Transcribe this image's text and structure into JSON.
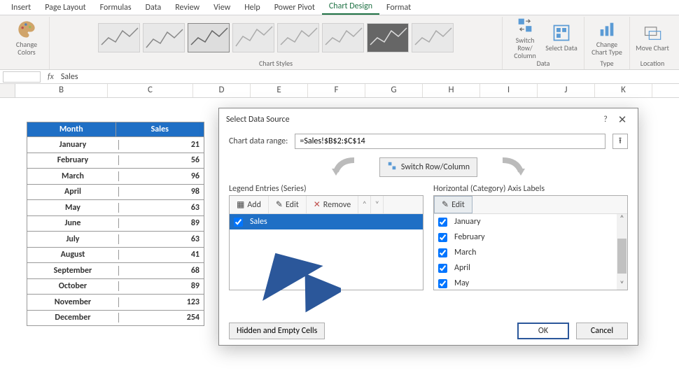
{
  "ribbon": {
    "tabs": [
      "Insert",
      "Page Layout",
      "Formulas",
      "Data",
      "Review",
      "View",
      "Help",
      "Power Pivot",
      "Chart Design",
      "Format"
    ],
    "active_tab": "Chart Design",
    "groups": {
      "change_colors": "Change\nColors",
      "chart_styles": "Chart Styles",
      "switch_rc": "Switch Row/\nColumn",
      "select_data": "Select\nData",
      "data": "Data",
      "change_type": "Change\nChart Type",
      "type": "Type",
      "move_chart": "Move\nChart",
      "location": "Location"
    }
  },
  "formula_bar": {
    "fx": "fx",
    "value": "Sales"
  },
  "columns": [
    "B",
    "C",
    "D",
    "E",
    "F",
    "G",
    "H",
    "I",
    "J",
    "K"
  ],
  "table": {
    "headers": {
      "month": "Month",
      "sales": "Sales"
    },
    "rows": [
      {
        "m": "January",
        "v": "21"
      },
      {
        "m": "February",
        "v": "56"
      },
      {
        "m": "March",
        "v": "96"
      },
      {
        "m": "April",
        "v": "98"
      },
      {
        "m": "May",
        "v": "63"
      },
      {
        "m": "June",
        "v": "89"
      },
      {
        "m": "July",
        "v": "63"
      },
      {
        "m": "August",
        "v": "41"
      },
      {
        "m": "September",
        "v": "68"
      },
      {
        "m": "October",
        "v": "89"
      },
      {
        "m": "November",
        "v": "123"
      },
      {
        "m": "December",
        "v": "254"
      }
    ]
  },
  "dialog": {
    "title": "Select Data Source",
    "help": "?",
    "close": "✕",
    "range_label": "Chart data range:",
    "range_value": "=Sales!$B$2:$C$14",
    "switch_btn": "Switch Row/Column",
    "legend_title": "Legend Entries (Series)",
    "axis_title": "Horizontal (Category) Axis Labels",
    "btn_add": "Add",
    "btn_edit": "Edit",
    "btn_remove": "Remove",
    "series": [
      "Sales"
    ],
    "categories": [
      "January",
      "February",
      "March",
      "April",
      "May"
    ],
    "hidden_cells": "Hidden and Empty Cells",
    "ok": "OK",
    "cancel": "Cancel"
  }
}
